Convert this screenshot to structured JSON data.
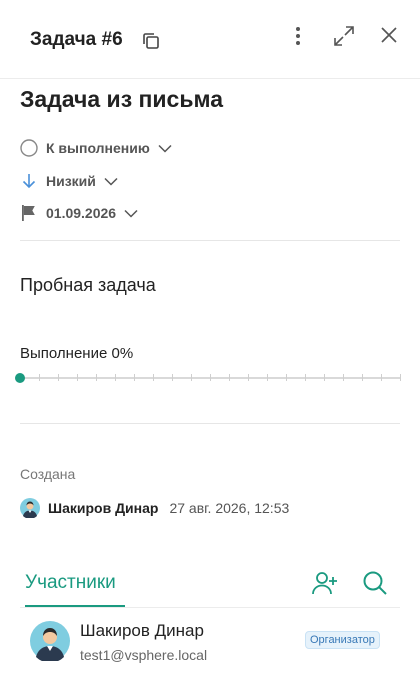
{
  "header": {
    "task_id": "Задача #6"
  },
  "task": {
    "title": "Задача из письма",
    "status": "К выполнению",
    "priority": "Низкий",
    "due_date": "01.09.2026",
    "description": "Пробная задача",
    "progress_label": "Выполнение 0%",
    "progress_value": 0
  },
  "created": {
    "label": "Создана",
    "author": "Шакиров Динар",
    "date": "27 авг. 2026, 12:53"
  },
  "participants": {
    "tab_label": "Участники",
    "items": [
      {
        "name": "Шакиров Динар",
        "email": "test1@vsphere.local",
        "role": "Организатор"
      }
    ]
  },
  "icons": {
    "copy": "copy-icon",
    "more": "more-vertical-icon",
    "expand": "expand-icon",
    "close": "close-icon",
    "status": "circle-icon",
    "priority": "arrow-down-icon",
    "date": "flag-icon",
    "add_user": "add-user-icon",
    "search": "search-icon"
  },
  "colors": {
    "accent": "#1a9a80",
    "priority_low": "#4a90d9",
    "role_badge_text": "#3878b6",
    "role_badge_bg": "#e6f2fb"
  }
}
